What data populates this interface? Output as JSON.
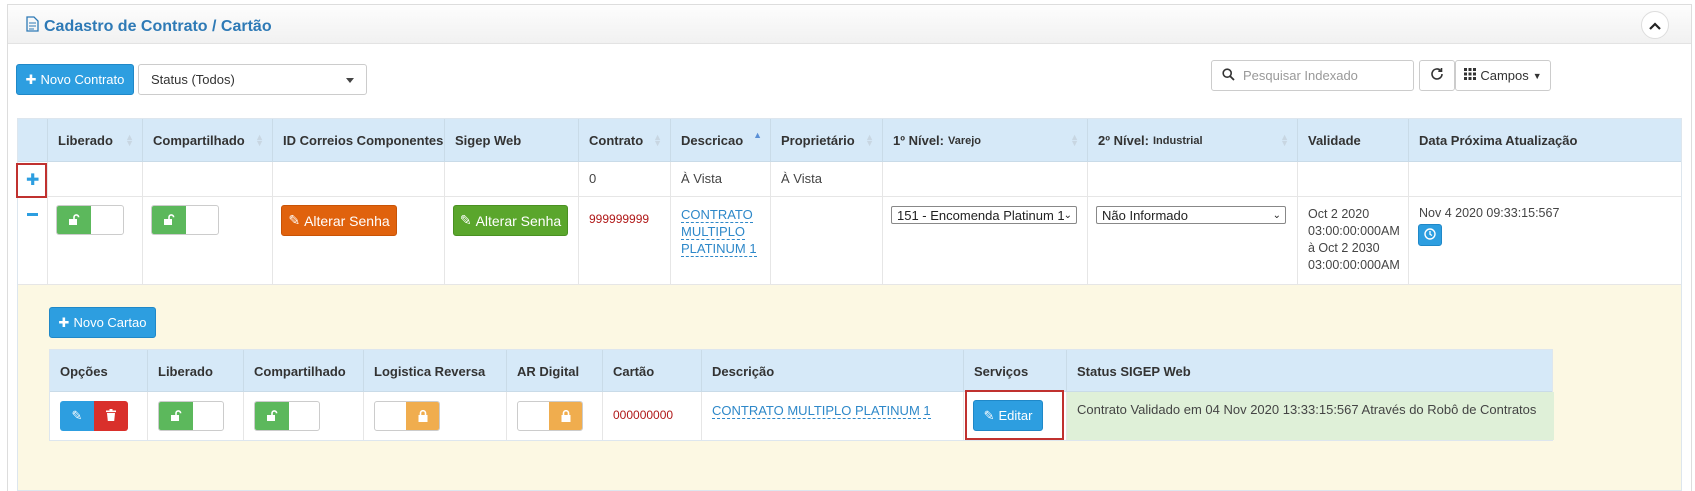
{
  "panel": {
    "title": "Cadastro de Contrato / Cartão",
    "icon": "document-icon",
    "collapse_icon": "chevron-up-icon"
  },
  "toolbar": {
    "new_contract_label": "Novo Contrato",
    "status_select_value": "Status (Todos)",
    "search_placeholder": "Pesquisar Indexado",
    "fields_label": "Campos"
  },
  "grid": {
    "columns": [
      {
        "label": "Liberado",
        "sub": ""
      },
      {
        "label": "Compartilhado",
        "sub": ""
      },
      {
        "label": "ID Correios Componentes",
        "sub": ""
      },
      {
        "label": "Sigep Web",
        "sub": ""
      },
      {
        "label": "Contrato",
        "sub": ""
      },
      {
        "label": "Descricao",
        "sub": ""
      },
      {
        "label": "Proprietário",
        "sub": ""
      },
      {
        "label": "1º Nível:",
        "sub": "Varejo"
      },
      {
        "label": "2º Nível:",
        "sub": "Industrial"
      },
      {
        "label": "Validade",
        "sub": ""
      },
      {
        "label": "Data Próxima Atualização",
        "sub": ""
      }
    ],
    "row1": {
      "contrato": "0",
      "descricao": "À Vista",
      "proprietario": "À Vista"
    },
    "row2": {
      "alterar_senha_1": "Alterar Senha",
      "alterar_senha_2": "Alterar Senha",
      "contrato": "999999999",
      "descricao_l1": "CONTRATO",
      "descricao_l2": "MULTIPLO",
      "descricao_l3": "PLATINUM 1",
      "nivel1_value": "151 - Encomenda Platinum 1",
      "nivel2_value": "Não Informado",
      "validade_l1": "Oct 2 2020",
      "validade_l2": "03:00:00:000AM",
      "validade_l3": "à Oct 2 2030",
      "validade_l4": "03:00:00:000AM",
      "proxima": "Nov 4 2020 09:33:15:567"
    }
  },
  "cards": {
    "new_card_label": "Novo Cartao",
    "columns": [
      "Opções",
      "Liberado",
      "Compartilhado",
      "Logistica Reversa",
      "AR Digital",
      "Cartão",
      "Descrição",
      "Serviços",
      "Status SIGEP Web"
    ],
    "row": {
      "cartao": "000000000",
      "descricao": "CONTRATO MULTIPLO PLATINUM 1",
      "servicos_label": "Editar",
      "status": "Contrato Validado em 04 Nov 2020 13:33:15:567 Através do Robô de Contratos"
    }
  },
  "colors": {
    "accent": "#2d9ee0",
    "header_bg": "#d6e9f8",
    "detail_bg": "#fcf8e3",
    "status_bg": "#dff0d8",
    "highlight": "#c0312f"
  }
}
